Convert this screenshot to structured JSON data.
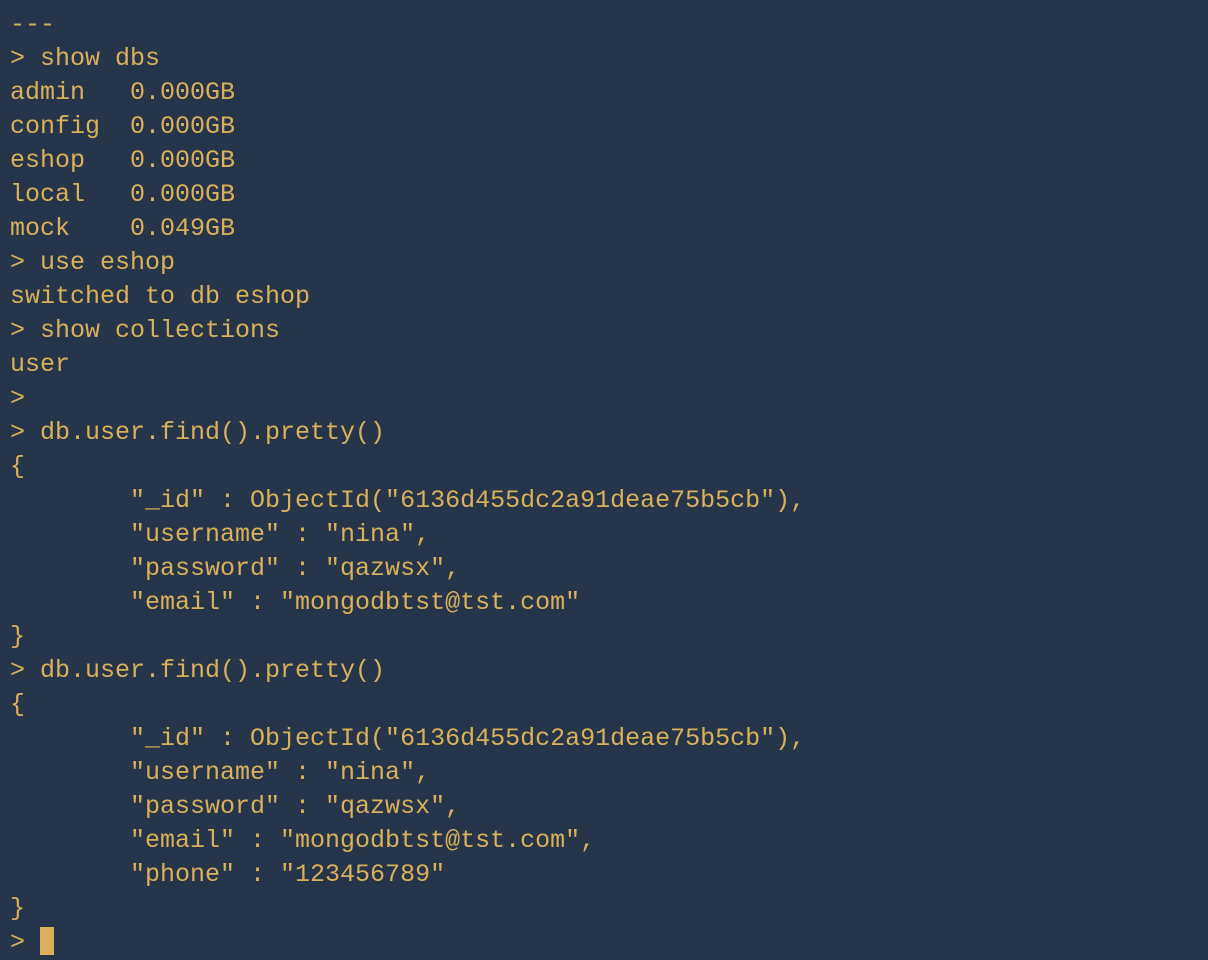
{
  "lines": [
    {
      "text": "---",
      "kind": "out"
    },
    {
      "text": "> show dbs",
      "kind": "cmd"
    },
    {
      "text": "admin   0.000GB",
      "kind": "out"
    },
    {
      "text": "config  0.000GB",
      "kind": "out"
    },
    {
      "text": "eshop   0.000GB",
      "kind": "out"
    },
    {
      "text": "local   0.000GB",
      "kind": "out"
    },
    {
      "text": "mock    0.049GB",
      "kind": "out"
    },
    {
      "text": "> use eshop",
      "kind": "cmd"
    },
    {
      "text": "switched to db eshop",
      "kind": "out"
    },
    {
      "text": "> show collections",
      "kind": "cmd"
    },
    {
      "text": "user",
      "kind": "out"
    },
    {
      "text": ">",
      "kind": "cmd"
    },
    {
      "text": "> db.user.find().pretty()",
      "kind": "cmd"
    },
    {
      "text": "{",
      "kind": "out"
    },
    {
      "text": "        \"_id\" : ObjectId(\"6136d455dc2a91deae75b5cb\"),",
      "kind": "out"
    },
    {
      "text": "        \"username\" : \"nina\",",
      "kind": "out"
    },
    {
      "text": "        \"password\" : \"qazwsx\",",
      "kind": "out"
    },
    {
      "text": "        \"email\" : \"mongodbtst@tst.com\"",
      "kind": "out"
    },
    {
      "text": "}",
      "kind": "out"
    },
    {
      "text": "> db.user.find().pretty()",
      "kind": "cmd"
    },
    {
      "text": "{",
      "kind": "out"
    },
    {
      "text": "        \"_id\" : ObjectId(\"6136d455dc2a91deae75b5cb\"),",
      "kind": "out"
    },
    {
      "text": "        \"username\" : \"nina\",",
      "kind": "out"
    },
    {
      "text": "        \"password\" : \"qazwsx\",",
      "kind": "out"
    },
    {
      "text": "        \"email\" : \"mongodbtst@tst.com\",",
      "kind": "out"
    },
    {
      "text": "        \"phone\" : \"123456789\"",
      "kind": "out"
    },
    {
      "text": "}",
      "kind": "out"
    }
  ],
  "final_prompt": "> ",
  "session": {
    "databases": [
      {
        "name": "admin",
        "size": "0.000GB"
      },
      {
        "name": "config",
        "size": "0.000GB"
      },
      {
        "name": "eshop",
        "size": "0.000GB"
      },
      {
        "name": "local",
        "size": "0.000GB"
      },
      {
        "name": "mock",
        "size": "0.049GB"
      }
    ],
    "current_db": "eshop",
    "collections": [
      "user"
    ],
    "documents": [
      {
        "_id": "6136d455dc2a91deae75b5cb",
        "username": "nina",
        "password": "qazwsx",
        "email": "mongodbtst@tst.com"
      },
      {
        "_id": "6136d455dc2a91deae75b5cb",
        "username": "nina",
        "password": "qazwsx",
        "email": "mongodbtst@tst.com",
        "phone": "123456789"
      }
    ]
  }
}
